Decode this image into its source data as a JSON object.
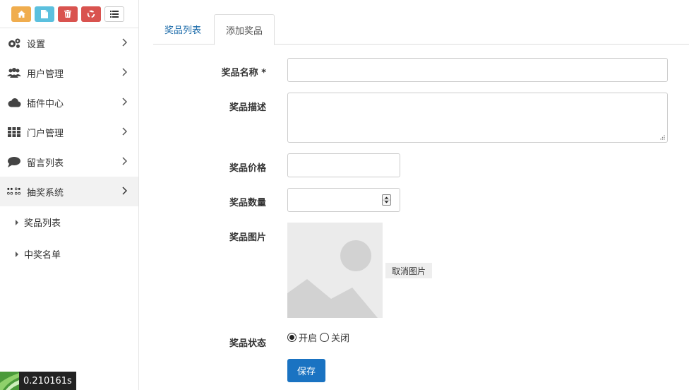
{
  "quickbar": {
    "icons": [
      "home-icon",
      "file-icon",
      "trash-icon",
      "recycle-icon",
      "list-icon"
    ],
    "colors": {
      "home": "#f0ad4e",
      "file": "#5bc0de",
      "trash": "#d9534f",
      "recycle": "#d9534f"
    }
  },
  "sidebar": {
    "items": [
      {
        "label": "设置",
        "icon": "gears-icon"
      },
      {
        "label": "用户管理",
        "icon": "users-icon"
      },
      {
        "label": "插件中心",
        "icon": "cloud-icon"
      },
      {
        "label": "门户管理",
        "icon": "grid-icon"
      },
      {
        "label": "留言列表",
        "icon": "comment-icon"
      },
      {
        "label": "抽奖系统",
        "icon": "dots-icon",
        "active": true
      }
    ],
    "subitems": [
      {
        "label": "奖品列表"
      },
      {
        "label": "中奖名单"
      }
    ]
  },
  "timer": {
    "value": "0.210161s"
  },
  "tabs": [
    {
      "label": "奖品列表",
      "active": false
    },
    {
      "label": "添加奖品",
      "active": true
    }
  ],
  "form": {
    "name_label": "奖品名称 *",
    "name_value": "",
    "desc_label": "奖品描述",
    "desc_value": "",
    "price_label": "奖品价格",
    "price_value": "",
    "qty_label": "奖品数量",
    "qty_value": "",
    "image_label": "奖品图片",
    "cancel_image_label": "取消图片",
    "status_label": "奖品状态",
    "status_on_label": "开启",
    "status_off_label": "关闭",
    "status_selected": "开启",
    "save_label": "保存"
  },
  "accent_color": "#1a73c2",
  "tab_link_color": "#1a6aa9"
}
